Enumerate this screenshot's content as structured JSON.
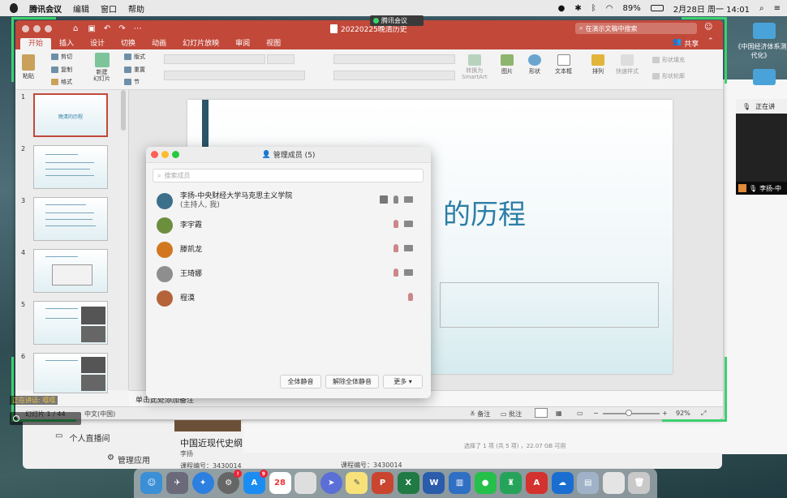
{
  "menubar": {
    "app": "腾讯会议",
    "menus": [
      "编辑",
      "窗口",
      "帮助"
    ],
    "battery": "89%",
    "datetime": "2月28日 周一  14:01"
  },
  "meeting_badge": "腾讯会议",
  "ppt": {
    "doc_title": "20220225晚清历史",
    "search_placeholder": "在演示文稿中搜索",
    "share_label": "共享",
    "tabs": [
      "开始",
      "插入",
      "设计",
      "切换",
      "动画",
      "幻灯片放映",
      "审阅",
      "视图"
    ],
    "ribbon": {
      "paste": "粘贴",
      "cut": "剪切",
      "copy": "复制",
      "format": "格式",
      "new_slide": "新建\n幻灯片",
      "layout": "版式",
      "reset": "重置",
      "section": "节",
      "smartart": "转换为\nSmartArt",
      "picture": "图片",
      "shape": "形状",
      "textbox": "文本框",
      "arrange": "排列",
      "quick_styles": "快速样式",
      "shape_fill": "形状填充",
      "shape_outline": "形状轮廓"
    },
    "thumbnails": [
      {
        "num": "1",
        "title": "晚清的历程"
      },
      {
        "num": "2",
        "title": ""
      },
      {
        "num": "3",
        "title": ""
      },
      {
        "num": "4",
        "title": ""
      },
      {
        "num": "5",
        "title": ""
      },
      {
        "num": "6",
        "title": ""
      }
    ],
    "slide_title": "的历程",
    "notes_placeholder": "单击此处添加备注",
    "status": {
      "slide_count": "幻灯片 1 / 44",
      "language": "中文(中国)",
      "notes": "备注",
      "comments": "批注",
      "zoom": "92%"
    }
  },
  "member_dialog": {
    "title": "管理成员 (5)",
    "search_placeholder": "搜索成员",
    "members": [
      {
        "name": "李扬-中央财经大学马克思主义学院",
        "role": "(主持人, 我)",
        "color": "#3c6f8a"
      },
      {
        "name": "李宇霞",
        "role": "",
        "color": "#6c8f3e"
      },
      {
        "name": "滕凯龙",
        "role": "",
        "color": "#d2771f"
      },
      {
        "name": "王琦娜",
        "role": "",
        "color": "#8e8e8e"
      },
      {
        "name": "程漠",
        "role": "",
        "color": "#b5643a"
      }
    ],
    "buttons": {
      "mute_all": "全体静音",
      "unmute_all": "解除全体静音",
      "more": "更多 ▾"
    }
  },
  "background": {
    "live": "个人直播间",
    "manage_apps": "管理应用",
    "course_title": "中国近现代史纲",
    "course_teacher": "李扬",
    "course_code": "课程编号：3430014",
    "course_code2": "课程编号：3430014",
    "selection_info": "选择了 1 项 (共 5 项) ，22.07 GB 可用",
    "desktop_file": "《中国经济体系测\n代化》",
    "video_name": "李扬-中",
    "video_top": "正在讲"
  },
  "speaking": "正在讲话: 嘻嘻",
  "dock": {
    "calendar_day": "28",
    "appstore_badge": "9"
  },
  "colors": {
    "ppt_red": "#c2483a",
    "share_green": "#3bd16f",
    "slide_title_blue": "#2c7ea7"
  }
}
